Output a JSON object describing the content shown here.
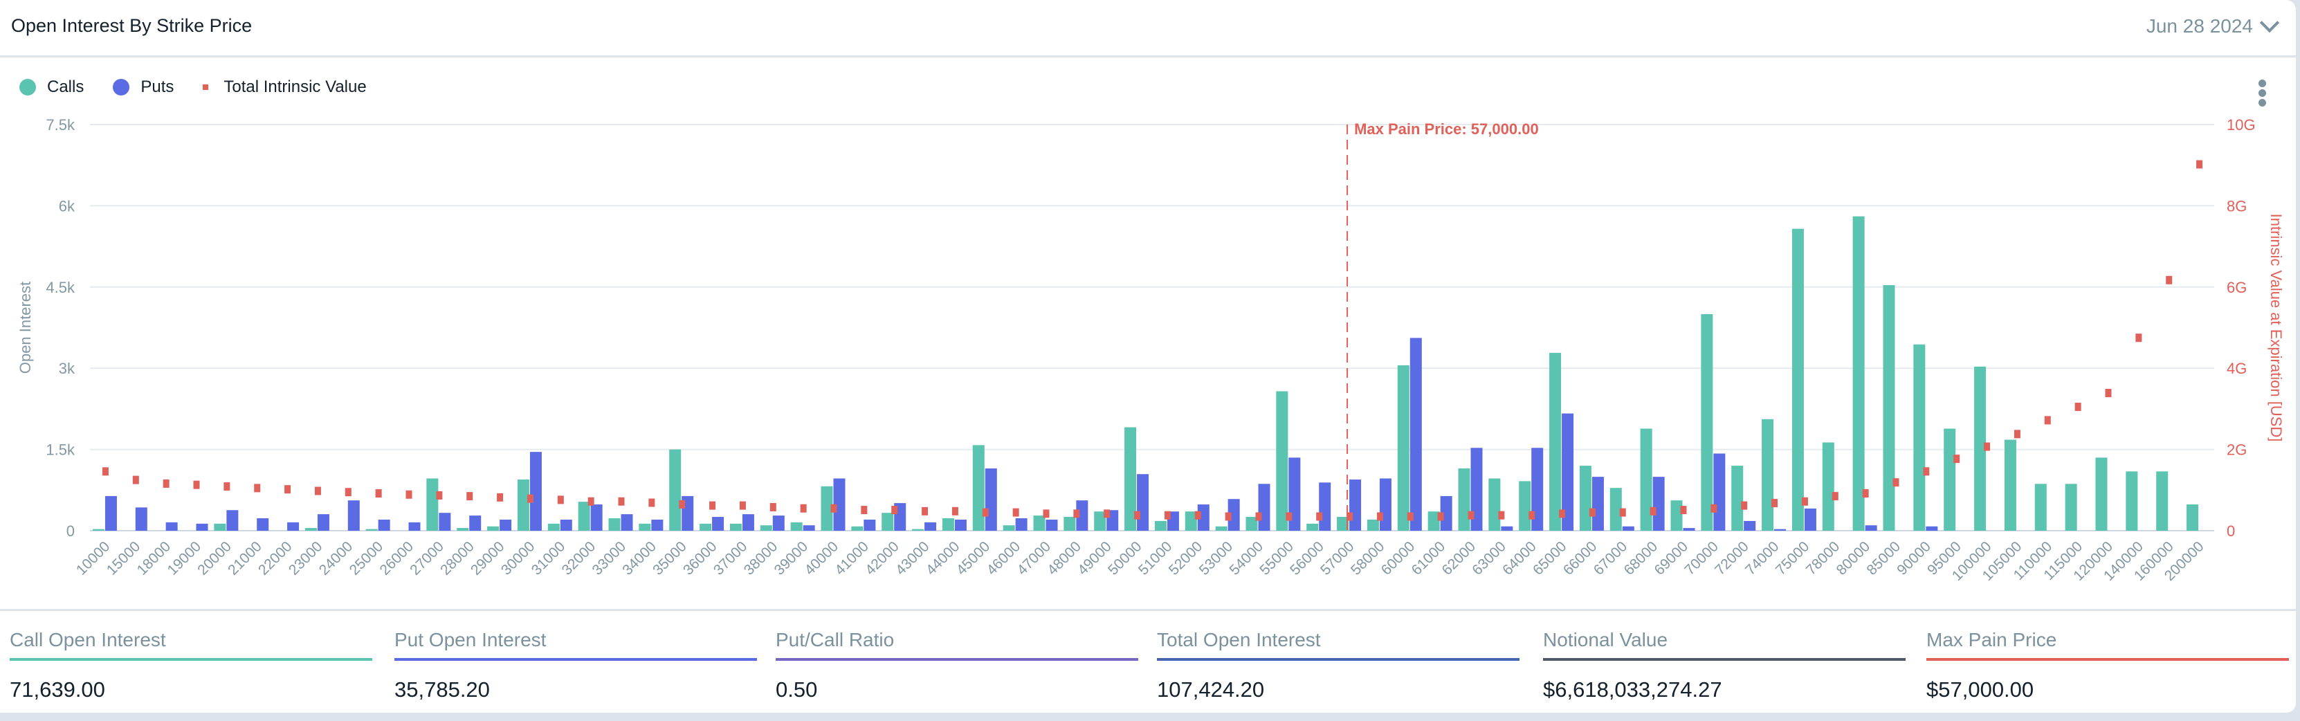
{
  "header": {
    "title": "Open Interest By Strike Price",
    "date": "Jun 28 2024"
  },
  "legend": [
    {
      "label": "Calls",
      "color": "#5ac4b0"
    },
    {
      "label": "Puts",
      "color": "#5b6be3"
    },
    {
      "label": "Total Intrinsic Value",
      "color": "#e0605a"
    }
  ],
  "chart_data": {
    "type": "bar",
    "title": "Open Interest By Strike Price",
    "xlabel": "",
    "ylabel": "Open Interest",
    "y2label": "Intrinsic Value at Expiration [USD]",
    "ylim": [
      0,
      7500
    ],
    "y2lim": [
      0,
      10
    ],
    "yticks": [
      "0",
      "1.5k",
      "3k",
      "4.5k",
      "6k",
      "7.5k"
    ],
    "y2ticks": [
      "0",
      "2G",
      "4G",
      "6G",
      "8G",
      "10G"
    ],
    "grid": true,
    "legend_position": "top-left",
    "annotation": {
      "label": "Max Pain Price: 57,000.00",
      "category": "57000"
    },
    "categories": [
      "10000",
      "15000",
      "18000",
      "19000",
      "20000",
      "21000",
      "22000",
      "23000",
      "24000",
      "25000",
      "26000",
      "27000",
      "28000",
      "29000",
      "30000",
      "31000",
      "32000",
      "33000",
      "34000",
      "35000",
      "36000",
      "37000",
      "38000",
      "39000",
      "40000",
      "41000",
      "42000",
      "43000",
      "44000",
      "45000",
      "46000",
      "47000",
      "48000",
      "49000",
      "50000",
      "51000",
      "52000",
      "53000",
      "54000",
      "55000",
      "56000",
      "57000",
      "58000",
      "60000",
      "61000",
      "62000",
      "63000",
      "64000",
      "65000",
      "66000",
      "67000",
      "68000",
      "69000",
      "70000",
      "72000",
      "74000",
      "75000",
      "78000",
      "80000",
      "85000",
      "90000",
      "95000",
      "100000",
      "105000",
      "110000",
      "115000",
      "120000",
      "140000",
      "160000",
      "200000"
    ],
    "series": [
      {
        "name": "Calls",
        "type": "bar",
        "axis": "left",
        "color": "#5ac4b0",
        "values": [
          30,
          0,
          0,
          0,
          130,
          0,
          0,
          50,
          0,
          30,
          0,
          965,
          50,
          80,
          945,
          130,
          535,
          230,
          130,
          1500,
          130,
          130,
          100,
          155,
          820,
          80,
          330,
          30,
          230,
          1580,
          100,
          280,
          255,
          355,
          1910,
          180,
          355,
          80,
          255,
          2575,
          130,
          255,
          205,
          3055,
          355,
          1150,
          965,
          915,
          3285,
          1200,
          790,
          1885,
          560,
          4000,
          1200,
          2060,
          5575,
          1630,
          5805,
          4535,
          3440,
          1885,
          3030,
          1680,
          865,
          865,
          1350,
          1095,
          1095,
          485
        ]
      },
      {
        "name": "Puts",
        "type": "bar",
        "axis": "left",
        "color": "#5b6be3",
        "values": [
          640,
          430,
          155,
          130,
          380,
          230,
          155,
          305,
          560,
          205,
          155,
          330,
          280,
          205,
          1455,
          205,
          485,
          305,
          205,
          640,
          255,
          305,
          280,
          100,
          965,
          205,
          510,
          155,
          205,
          1150,
          230,
          205,
          560,
          380,
          1045,
          355,
          485,
          585,
          865,
          1350,
          890,
          945,
          965,
          3560,
          640,
          1530,
          80,
          1530,
          2165,
          995,
          80,
          995,
          50,
          1425,
          180,
          30,
          410,
          0,
          100,
          0,
          80,
          0,
          0,
          0,
          0,
          0,
          0,
          0,
          0,
          0
        ]
      },
      {
        "name": "Total Intrinsic Value",
        "type": "scatter",
        "axis": "right",
        "unit": "G USD",
        "color": "#e0605a",
        "values": [
          1.46,
          1.25,
          1.16,
          1.13,
          1.09,
          1.05,
          1.02,
          0.98,
          0.95,
          0.92,
          0.89,
          0.87,
          0.85,
          0.82,
          0.79,
          0.76,
          0.72,
          0.72,
          0.69,
          0.65,
          0.62,
          0.62,
          0.58,
          0.55,
          0.55,
          0.51,
          0.51,
          0.48,
          0.48,
          0.45,
          0.45,
          0.42,
          0.42,
          0.42,
          0.38,
          0.38,
          0.38,
          0.35,
          0.35,
          0.35,
          0.35,
          0.35,
          0.35,
          0.35,
          0.35,
          0.38,
          0.38,
          0.38,
          0.42,
          0.45,
          0.45,
          0.48,
          0.51,
          0.55,
          0.62,
          0.68,
          0.72,
          0.85,
          0.92,
          1.19,
          1.46,
          1.77,
          2.07,
          2.38,
          2.72,
          3.05,
          3.39,
          4.75,
          6.17,
          9.02
        ]
      }
    ]
  },
  "stats": [
    {
      "label": "Call Open Interest",
      "value": "71,639.00",
      "color": "#5ac4b0"
    },
    {
      "label": "Put Open Interest",
      "value": "35,785.20",
      "color": "#5b6be3"
    },
    {
      "label": "Put/Call Ratio",
      "value": "0.50",
      "color": "#7668c2"
    },
    {
      "label": "Total Open Interest",
      "value": "107,424.20",
      "color": "#4866b0"
    },
    {
      "label": "Notional Value",
      "value": "$6,618,033,274.27",
      "color": "#4f5b6b"
    },
    {
      "label": "Max Pain Price",
      "value": "$57,000.00",
      "color": "#e0605a"
    }
  ]
}
